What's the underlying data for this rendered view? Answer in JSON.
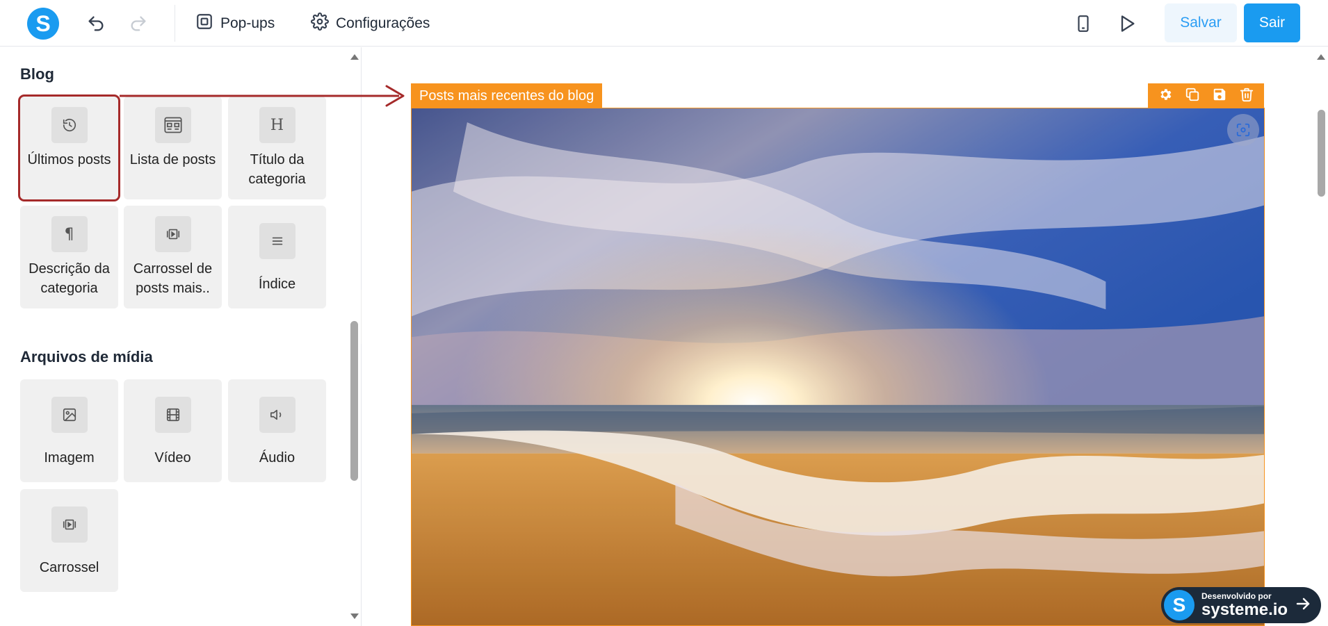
{
  "topbar": {
    "logo_letter": "S",
    "popups_label": "Pop-ups",
    "settings_label": "Configurações",
    "save_label": "Salvar",
    "exit_label": "Sair"
  },
  "panel": {
    "blog_title": "Blog",
    "blog_items": [
      {
        "label": "Últimos posts",
        "icon": "clock-rotate-icon"
      },
      {
        "label": "Lista de posts",
        "icon": "post-list-icon"
      },
      {
        "label": "Título da categoria",
        "icon": "heading-icon"
      },
      {
        "label": "Descrição da categoria",
        "icon": "paragraph-icon"
      },
      {
        "label": "Carrossel de posts mais..",
        "icon": "carousel-icon"
      },
      {
        "label": "Índice",
        "icon": "list-icon"
      }
    ],
    "media_title": "Arquivos de mídia",
    "media_items": [
      {
        "label": "Imagem",
        "icon": "image-icon"
      },
      {
        "label": "Vídeo",
        "icon": "video-icon"
      },
      {
        "label": "Áudio",
        "icon": "audio-icon"
      },
      {
        "label": "Carrossel",
        "icon": "carousel-icon"
      }
    ]
  },
  "canvas": {
    "block_label": "Posts mais recentes do blog",
    "highlight_color": "#a52a2a",
    "accent_color": "#f7931e"
  },
  "badge": {
    "line1": "Desenvolvido por",
    "line2": "systeme.io"
  },
  "colors": {
    "brand": "#1a9bf0",
    "save_bg": "#eef6fd"
  }
}
